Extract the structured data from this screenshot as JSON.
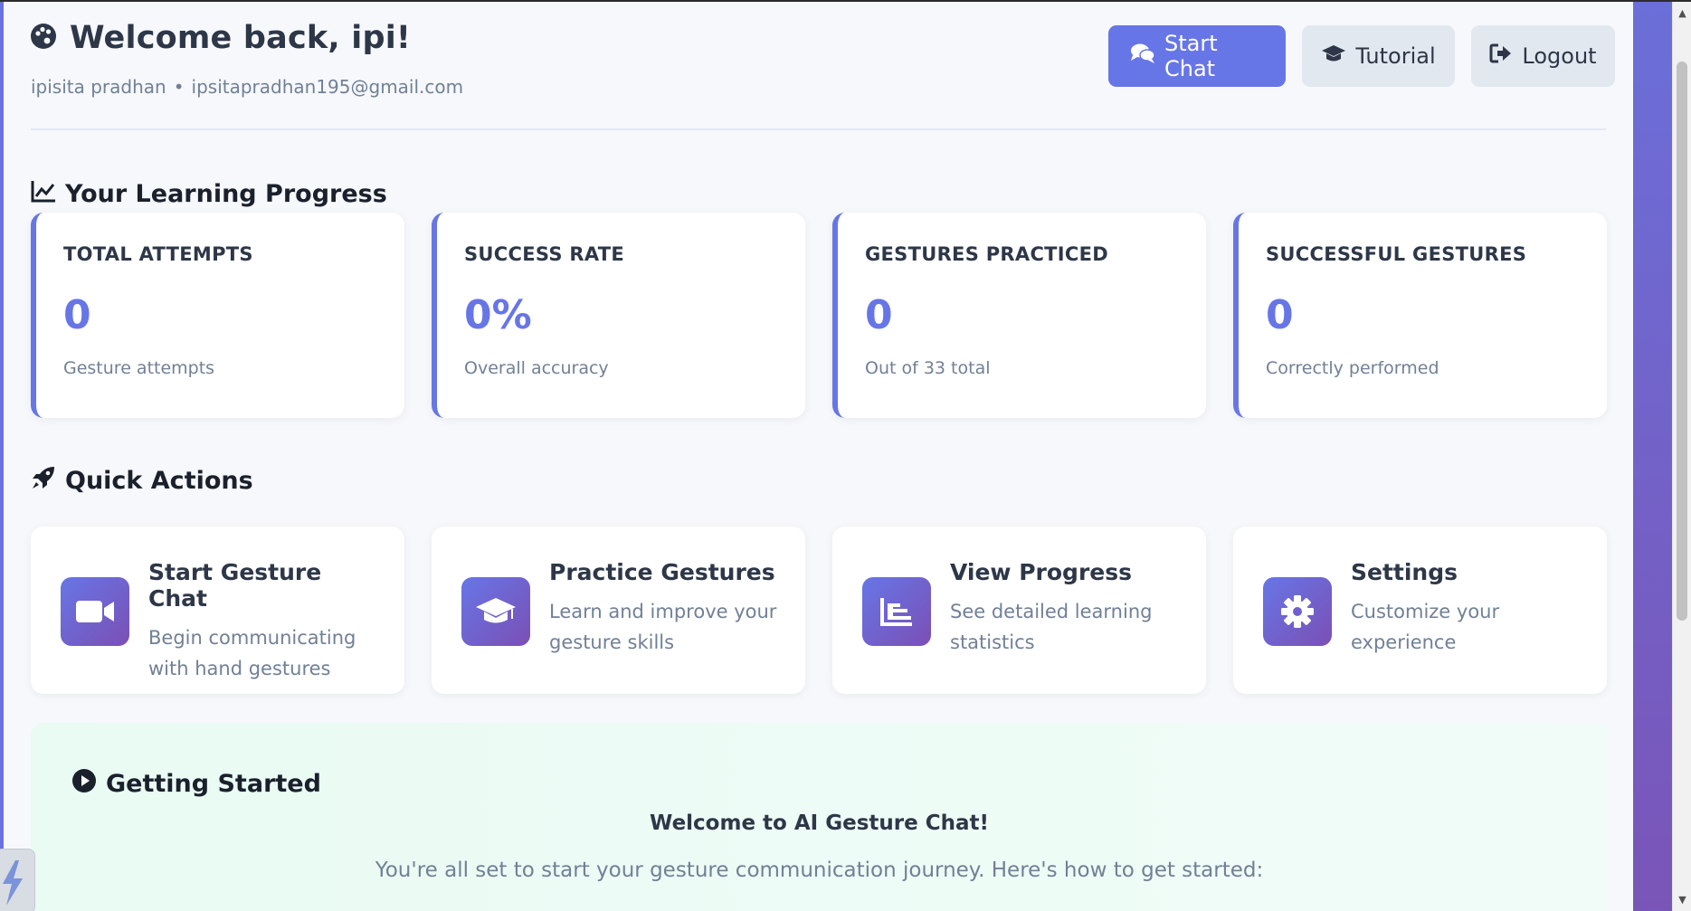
{
  "header": {
    "welcome_title": "Welcome back, ipi!",
    "user_name": "ipisita pradhan",
    "separator": "•",
    "user_email": "ipsitapradhan195@gmail.com",
    "buttons": {
      "start_chat": "Start Chat",
      "tutorial": "Tutorial",
      "logout": "Logout"
    }
  },
  "progress": {
    "heading": "Your Learning Progress",
    "cards": [
      {
        "label": "TOTAL ATTEMPTS",
        "value": "0",
        "sub": "Gesture attempts"
      },
      {
        "label": "SUCCESS RATE",
        "value": "0%",
        "sub": "Overall accuracy"
      },
      {
        "label": "GESTURES PRACTICED",
        "value": "0",
        "sub": "Out of 33 total"
      },
      {
        "label": "SUCCESSFUL GESTURES",
        "value": "0",
        "sub": "Correctly performed"
      }
    ]
  },
  "quick_actions": {
    "heading": "Quick Actions",
    "items": [
      {
        "title": "Start Gesture Chat",
        "desc": "Begin communicating with hand gestures",
        "icon": "video-icon"
      },
      {
        "title": "Practice Gestures",
        "desc": "Learn and improve your gesture skills",
        "icon": "graduation-cap-icon"
      },
      {
        "title": "View Progress",
        "desc": "See detailed learning statistics",
        "icon": "chart-icon"
      },
      {
        "title": "Settings",
        "desc": "Customize your experience",
        "icon": "gear-icon"
      }
    ]
  },
  "getting_started": {
    "heading": "Getting Started",
    "welcome": "Welcome to AI Gesture Chat!",
    "text": "You're all set to start your gesture communication journey. Here's how to get started:"
  },
  "colors": {
    "accent": "#6776e6",
    "accent_purple": "#7b4fb5",
    "heading_text": "#2d3748",
    "muted_text": "#718096",
    "panel_bg": "#f7f8fc",
    "getting_started_bg": "#e9fbf3"
  }
}
